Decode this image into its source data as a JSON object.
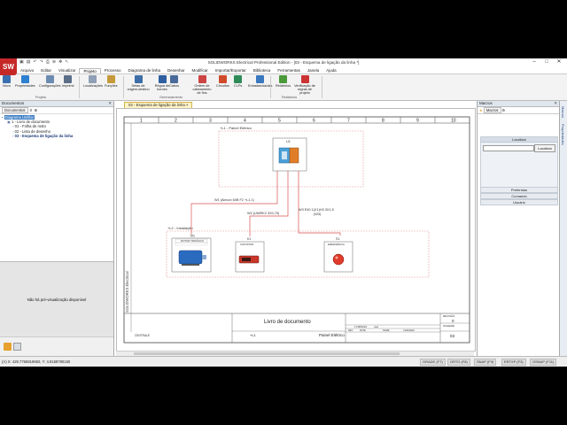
{
  "app": {
    "logo": "SW",
    "window_title": "SOLIDWORKS Electrical Professional Edition - [03 - Esquema de ligação da linha *]",
    "menu": [
      "Arquivo",
      "Editar",
      "Visualizar",
      "Projeto",
      "Processo",
      "Diagrama de linha",
      "Desenhar",
      "Modificar",
      "Importar/Exportar",
      "Biblioteca",
      "Ferramentas",
      "Janela",
      "Ajuda"
    ],
    "active_menu": "Projeto"
  },
  "ribbon": {
    "buttons": [
      {
        "label": "Novo",
        "color": "#3a6fb0"
      },
      {
        "label": "Propriedades",
        "color": "#2d7fd0"
      },
      {
        "label": "Configurações",
        "color": "#6c8bb0"
      },
      {
        "label": "Imprimir",
        "color": "#5c6f88"
      },
      {
        "label": "Localizações",
        "color": "#8f9fb5"
      },
      {
        "label": "Funções",
        "color": "#c59a3a"
      },
      {
        "label": "Setas de origem-destino",
        "color": "#3d6ea8"
      },
      {
        "label": "Régua de bornes",
        "color": "#2e5fa0"
      },
      {
        "label": "Cabos",
        "color": "#4a6a9a"
      },
      {
        "label": "Ordem de cabeamento de fios",
        "color": "#c44"
      },
      {
        "label": "Circuitos",
        "color": "#d04a2a"
      },
      {
        "label": "CLPs",
        "color": "#2e8b57"
      },
      {
        "label": "Entradas/saídas",
        "color": "#3a78c0"
      },
      {
        "label": "Relatórios",
        "color": "#4a9a3a"
      },
      {
        "label": "Verificação de regras de projeto",
        "color": "#c33"
      }
    ],
    "groups": [
      "Projeto",
      "Gerenciamento",
      "Relatórios"
    ]
  },
  "documents_panel": {
    "title": "Documentos",
    "tab_label": "Documentos",
    "tree": [
      {
        "label": "Diagrama Unifilar",
        "kind": "root-selected"
      },
      {
        "label": "1 - Livro de documento",
        "kind": "book"
      },
      {
        "label": "01 - Folha de rosto",
        "kind": "doc"
      },
      {
        "label": "02 - Lista de desenho",
        "kind": "doc"
      },
      {
        "label": "03 - Esquema de ligação da linha",
        "kind": "doc-active"
      }
    ],
    "preview_text": "Não há pré-visualização disponível"
  },
  "document_tab": {
    "label": "03 - Esquema de ligação da linha ×"
  },
  "drawing": {
    "columns": [
      "1",
      "2",
      "3",
      "4",
      "5",
      "6",
      "7",
      "8",
      "9",
      "10"
    ],
    "panel_location_label": "+L1 - Painel Elétrico",
    "install_location_label": "+L2 - Instalação",
    "panel_device_tag": "U1",
    "motor_tag": "M1",
    "motor_name": "MOTOR TRIFÁSICO",
    "contactor_tag": "K1",
    "contactor_name": "CONTATOR",
    "button_tag": "S1",
    "button_name": "EMERGÊNCIA",
    "cable_1_label": "W1 (Alecon 60B F2 +L1.1)",
    "cable_2_label": "W2 (UNIRK2 3X0,75)",
    "cable_3_label": "W3 E40 1(X1)H3 3X1,5",
    "cable_3_sub": "(W3)",
    "brand_vertical": "SOLIDWORKS Electrical",
    "title_block": {
      "doc_title": "Livro de documento",
      "revision_label": "REVISÃO",
      "revision_value": "0",
      "scheme_label": "SCHEME",
      "scheme_value": "03",
      "location_code": "+L1",
      "panel_name": "Painel Elétrico",
      "company": "CENTRALE",
      "date": "17/08/2022",
      "user": "user",
      "col_rev": "REV",
      "col_date": "DATE",
      "col_name": "NAME",
      "col_changes": "CHANGES"
    }
  },
  "macros_panel": {
    "title": "Macros",
    "tab_label": "Macros",
    "search_header": "Localizar",
    "search_button": "Localizar",
    "sections": [
      "Preferidas",
      "Comando",
      "Usuário"
    ]
  },
  "vertical_tabs": [
    "Macros",
    "Propriedades"
  ],
  "status_bar": {
    "coords": "(A) X: 429.7766919650, Y: 4.9169790150",
    "toggles": [
      "GRADE (F7)",
      "ORTO (F8)",
      "SNAP (F9)",
      "ERTXP (F3)",
      "OSNAP (F11)"
    ]
  }
}
